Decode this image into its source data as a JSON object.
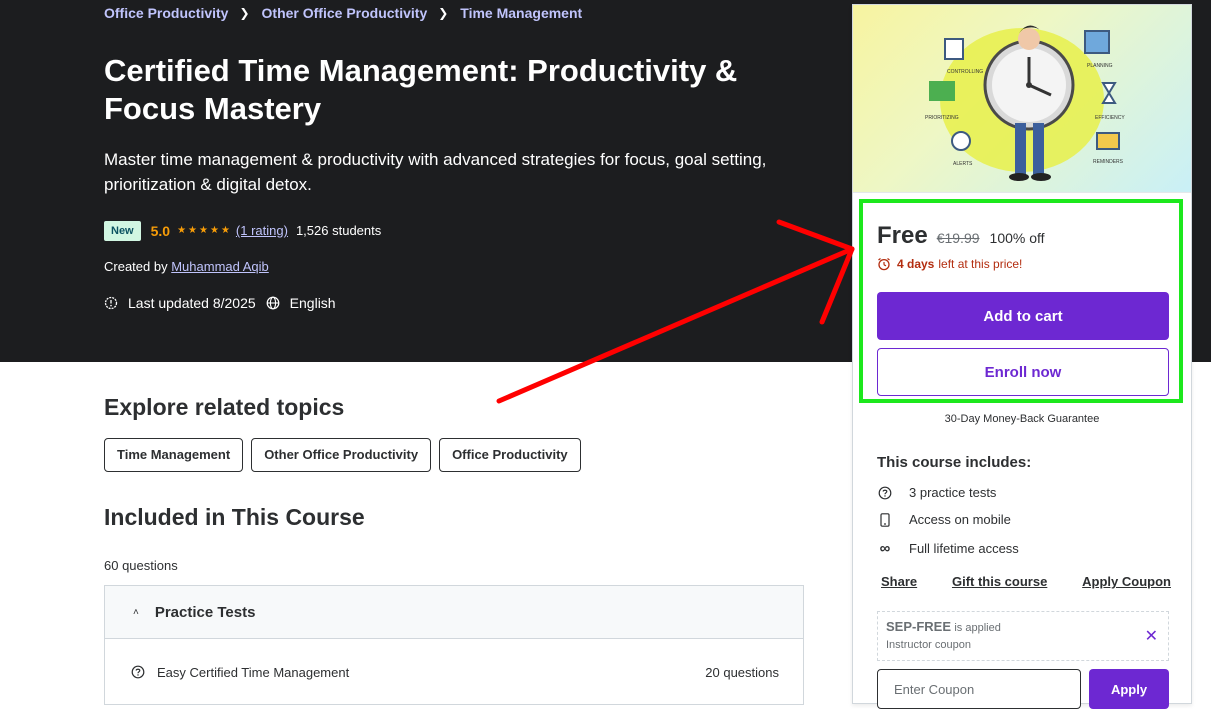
{
  "breadcrumb": [
    "Office Productivity",
    "Other Office Productivity",
    "Time Management"
  ],
  "course": {
    "title": "Certified Time Management: Productivity & Focus Mastery",
    "subtitle": "Master time management & productivity with advanced strategies for focus, goal setting, prioritization & digital detox.",
    "badge": "New",
    "rating": "5.0",
    "rating_count": "(1 rating)",
    "students": "1,526 students",
    "created_by_label": "Created by",
    "author": "Muhammad Aqib",
    "last_updated": "Last updated 8/2025",
    "language": "English",
    "stars": 5
  },
  "related": {
    "heading": "Explore related topics",
    "topics": [
      "Time Management",
      "Other Office Productivity",
      "Office Productivity"
    ]
  },
  "included": {
    "heading": "Included in This Course",
    "count": "60 questions",
    "section_title": "Practice Tests",
    "items": [
      {
        "label": "Easy Certified Time Management",
        "questions": "20 questions"
      }
    ]
  },
  "purchase": {
    "price": "Free",
    "original_price": "€19.99",
    "discount": "100% off",
    "timer_bold": "4 days",
    "timer_rest": "left at this price!",
    "add_to_cart": "Add to cart",
    "enroll_now": "Enroll now",
    "guarantee": "30-Day Money-Back Guarantee",
    "includes_title": "This course includes:",
    "includes": [
      "3 practice tests",
      "Access on mobile",
      "Full lifetime access"
    ],
    "links": [
      "Share",
      "Gift this course",
      "Apply Coupon"
    ],
    "coupon_code": "SEP-FREE",
    "coupon_applied": "is applied",
    "coupon_type": "Instructor coupon",
    "coupon_placeholder": "Enter Coupon",
    "apply": "Apply"
  },
  "thumbnail_labels": [
    "CONTROLLING",
    "PLANNING",
    "PRIORITIZING",
    "EFFICIENCY",
    "ALERTS",
    "REMINDERS"
  ],
  "colors": {
    "hero_bg": "#1c1d1f",
    "link_purple": "#c0c4fc",
    "primary_purple": "#6d28d2",
    "star_orange": "#f69c08",
    "alert_red": "#b32d0f",
    "highlight_green": "#1de81d",
    "arrow_red": "#ff0000"
  }
}
